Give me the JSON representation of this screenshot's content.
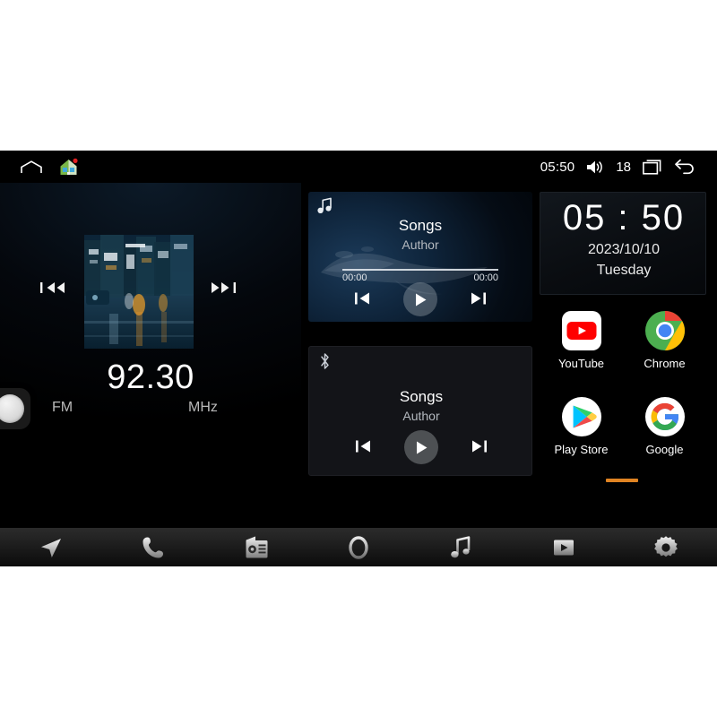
{
  "statusbar": {
    "home_icon": "home-outline-icon",
    "house_icon": "house-app-icon",
    "clock": "05:50",
    "volume_icon": "speaker-volume-icon",
    "volume_level": "18",
    "recents_icon": "recent-apps-icon",
    "back_icon": "back-arrow-icon"
  },
  "radio": {
    "prev_icon": "seek-down-icon",
    "next_icon": "seek-up-icon",
    "frequency": "92.30",
    "band": "FM",
    "unit": "MHz",
    "knob_icon": "rotary-knob"
  },
  "media_widget": {
    "source_icon": "music-note-icon",
    "title": "Songs",
    "artist": "Author",
    "elapsed": "00:00",
    "duration": "00:00",
    "prev_icon": "previous-track-icon",
    "play_icon": "play-icon",
    "next_icon": "next-track-icon"
  },
  "bluetooth_widget": {
    "source_icon": "bluetooth-icon",
    "title": "Songs",
    "artist": "Author",
    "prev_icon": "previous-track-icon",
    "play_icon": "play-icon",
    "next_icon": "next-track-icon"
  },
  "clock_widget": {
    "time": "05 : 50",
    "date": "2023/10/10",
    "weekday": "Tuesday"
  },
  "apps": [
    {
      "label": "YouTube",
      "icon": "youtube-icon"
    },
    {
      "label": "Chrome",
      "icon": "chrome-icon"
    },
    {
      "label": "Play Store",
      "icon": "play-store-icon"
    },
    {
      "label": "Google",
      "icon": "google-icon"
    }
  ],
  "page_indicator": {
    "color": "#e08423"
  },
  "dock": [
    {
      "name": "navigation",
      "icon": "navigation-arrow-icon"
    },
    {
      "name": "phone",
      "icon": "phone-icon"
    },
    {
      "name": "radio",
      "icon": "radio-icon"
    },
    {
      "name": "apps",
      "icon": "circle-apps-icon"
    },
    {
      "name": "music",
      "icon": "music-note-icon"
    },
    {
      "name": "video",
      "icon": "video-play-icon"
    },
    {
      "name": "settings",
      "icon": "gear-icon"
    }
  ],
  "colors": {
    "accent_orange": "#e08423",
    "screen_background": "#000000",
    "dock_background": "#1d1d1d"
  }
}
